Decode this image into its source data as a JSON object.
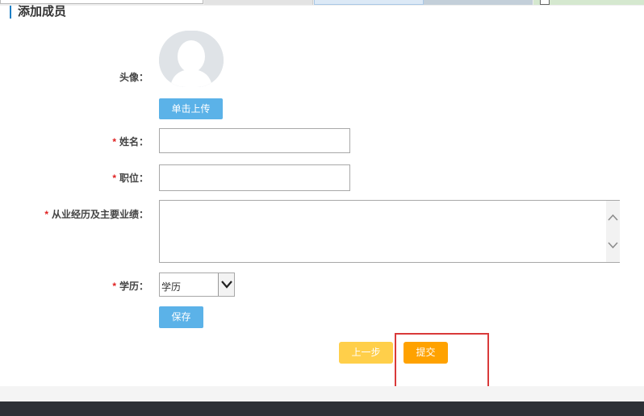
{
  "section": {
    "title": "添加成员"
  },
  "form": {
    "avatar_label": "头像：",
    "upload_button": "单击上传",
    "required_mark": "*",
    "name_label": "姓名：",
    "name_value": "",
    "position_label": "职位：",
    "position_value": "",
    "experience_label": "从业经历及主要业绩：",
    "experience_value": "",
    "education_label": "学历：",
    "education_selected": "学历",
    "save_button": "保存"
  },
  "actions": {
    "prev_button": "上一步",
    "submit_button": "提交"
  },
  "colors": {
    "accent_blue": "#5bb2e8",
    "prev_yellow": "#ffcf4a",
    "submit_orange": "#ffa200",
    "highlight_red": "#d93a3a",
    "required_red": "#e02020",
    "footer_dark": "#2e3137"
  }
}
